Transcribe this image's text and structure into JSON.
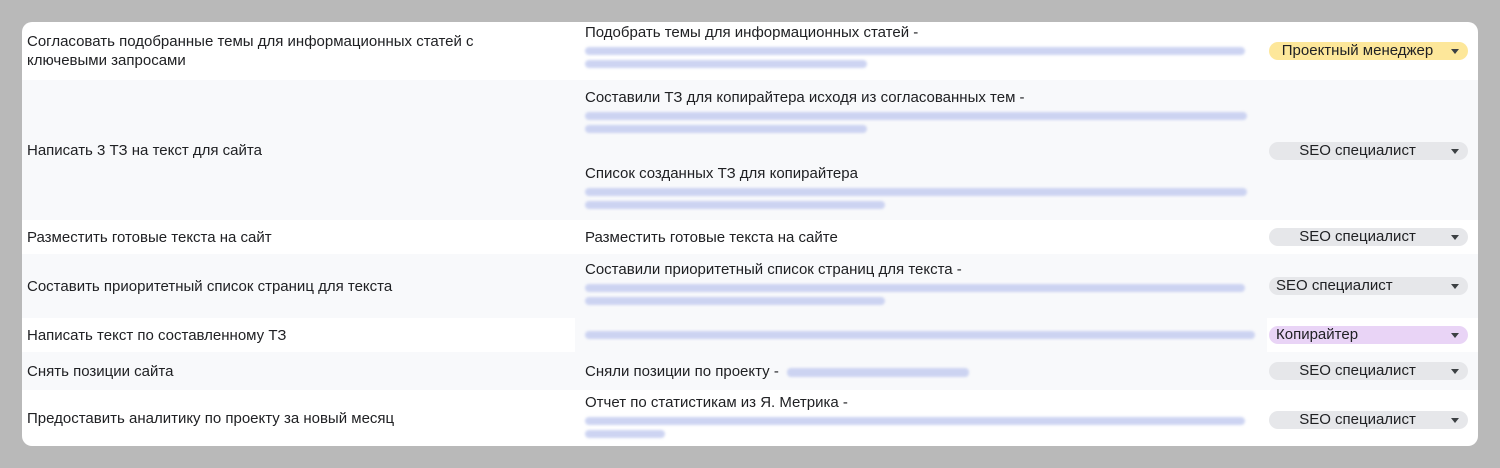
{
  "rows": [
    {
      "task": "Согласовать подобранные темы для информационных статей с ключевыми запросами",
      "results": [
        "Подобрать темы для информационных статей -"
      ],
      "role": "Проектный менеджер",
      "role_color": "#fde79a"
    },
    {
      "task": "Написать 3 ТЗ на текст для сайта",
      "results": [
        "Составили ТЗ для копирайтера исходя из согласованных тем -",
        "Список созданных ТЗ для копирайтера"
      ],
      "role": "SEO специалист",
      "role_color": "#e6e7ea"
    },
    {
      "task": "Разместить готовые текста на сайт",
      "results": [
        "Разместить готовые текста на сайте"
      ],
      "role": "SEO специалист",
      "role_color": "#e6e7ea"
    },
    {
      "task": "Составить приоритетный список страниц для текста",
      "results": [
        "Составили приоритетный список страниц для текста -"
      ],
      "role": "SEO специалист",
      "role_color": "#e6e7ea"
    },
    {
      "task": "Написать текст по составленному ТЗ",
      "results": [],
      "role": "Копирайтер",
      "role_color": "#e9d4f6"
    },
    {
      "task": "Снять позиции сайта",
      "results": [
        "Сняли позиции по проекту -"
      ],
      "role": "SEO специалист",
      "role_color": "#e6e7ea"
    },
    {
      "task": "Предоставить аналитику по проекту за новый месяц",
      "results": [
        "Отчет по статистикам из Я. Метрика -"
      ],
      "role": "SEO специалист",
      "role_color": "#e6e7ea"
    }
  ],
  "icons": {
    "dropdown": "chevron-down-icon"
  }
}
